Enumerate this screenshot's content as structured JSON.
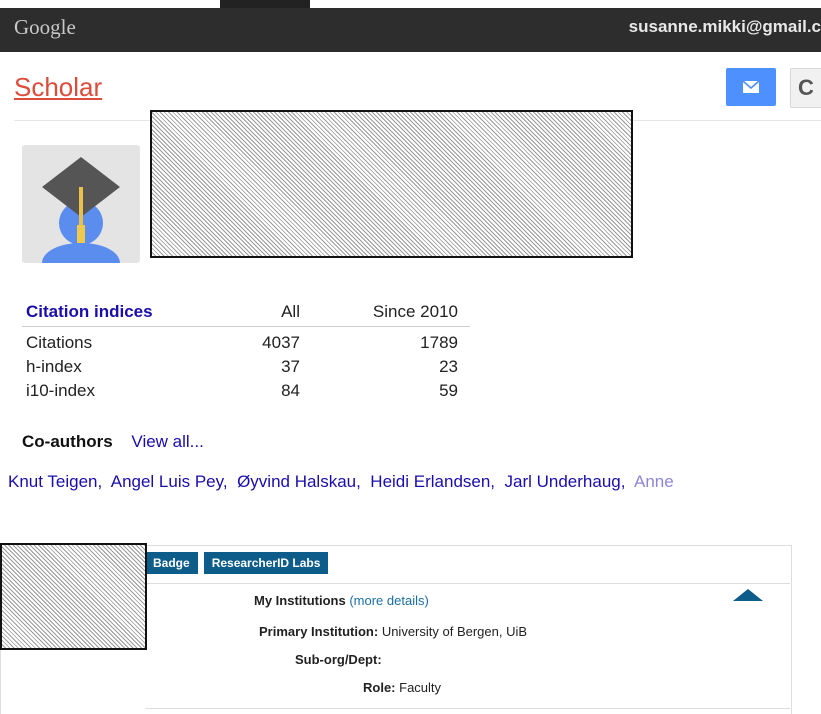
{
  "header": {
    "logo": "Google",
    "account_email": "susanne.mikki@gmail.c"
  },
  "scholar": {
    "title": "Scholar"
  },
  "citations": {
    "title": "Citation indices",
    "col_all": "All",
    "col_since": "Since 2010",
    "rows": [
      {
        "label": "Citations",
        "all": "4037",
        "since": "1789"
      },
      {
        "label": "h-index",
        "all": "37",
        "since": "23"
      },
      {
        "label": "i10-index",
        "all": "84",
        "since": "59"
      }
    ]
  },
  "coauthors": {
    "label": "Co-authors",
    "view_all": "View all...",
    "names": [
      "Knut Teigen,",
      "Angel Luis Pey,",
      "Øyvind Halskau,",
      "Heidi Erlandsen,",
      "Jarl Underhaug,",
      "Anne"
    ]
  },
  "researcherid": {
    "tabs": [
      "Badge",
      "ResearcherID Labs"
    ],
    "institutions_label": "My Institutions",
    "more_details": "(more details)",
    "primary_label": "Primary Institution:",
    "primary_value": "University of Bergen, UiB",
    "suborg_label": "Sub-org/Dept:",
    "role_label": "Role:",
    "role_value": "Faculty"
  },
  "colors": {
    "accent": "#dd4b39",
    "link": "#1a0dab",
    "button_blue": "#4d90fe",
    "rid_tab": "#0e5c8a"
  }
}
